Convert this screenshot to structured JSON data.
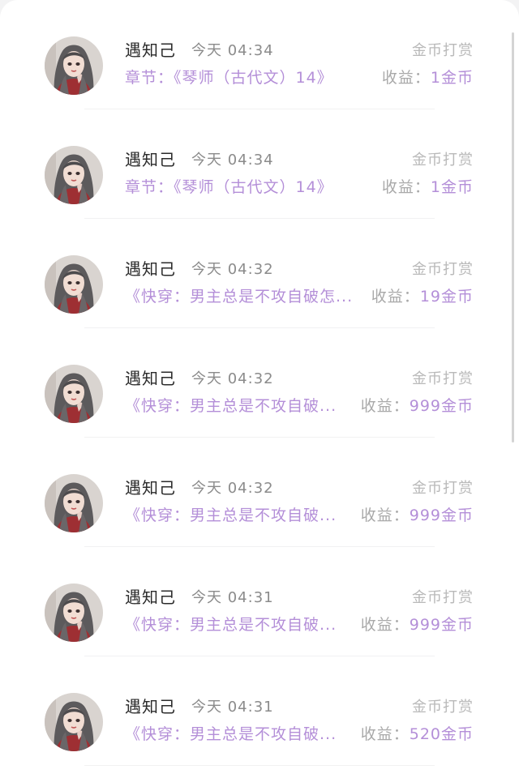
{
  "colors": {
    "accent_purple": "#b48fd8",
    "name_text": "#2b2b2b",
    "muted_text": "#8b8b8b",
    "light_text": "#b9b9b9"
  },
  "rows": [
    {
      "name": "遇知己",
      "time": "今天 04:34",
      "type": "金币打赏",
      "chapter": "章节：《琴师（古代文）14》",
      "income_label": "收益：",
      "income_amount": "1金币"
    },
    {
      "name": "遇知己",
      "time": "今天 04:34",
      "type": "金币打赏",
      "chapter": "章节：《琴师（古代文）14》",
      "income_label": "收益：",
      "income_amount": "1金币"
    },
    {
      "name": "遇知己",
      "time": "今天 04:32",
      "type": "金币打赏",
      "chapter": "《快穿：男主总是不攻自破怎...",
      "income_label": "收益：",
      "income_amount": "19金币"
    },
    {
      "name": "遇知己",
      "time": "今天 04:32",
      "type": "金币打赏",
      "chapter": "《快穿：男主总是不攻自破...",
      "income_label": "收益：",
      "income_amount": "999金币"
    },
    {
      "name": "遇知己",
      "time": "今天 04:32",
      "type": "金币打赏",
      "chapter": "《快穿：男主总是不攻自破...",
      "income_label": "收益：",
      "income_amount": "999金币"
    },
    {
      "name": "遇知己",
      "time": "今天 04:31",
      "type": "金币打赏",
      "chapter": "《快穿：男主总是不攻自破...",
      "income_label": "收益：",
      "income_amount": "999金币"
    },
    {
      "name": "遇知己",
      "time": "今天 04:31",
      "type": "金币打赏",
      "chapter": "《快穿：男主总是不攻自破...",
      "income_label": "收益：",
      "income_amount": "520金币"
    }
  ]
}
